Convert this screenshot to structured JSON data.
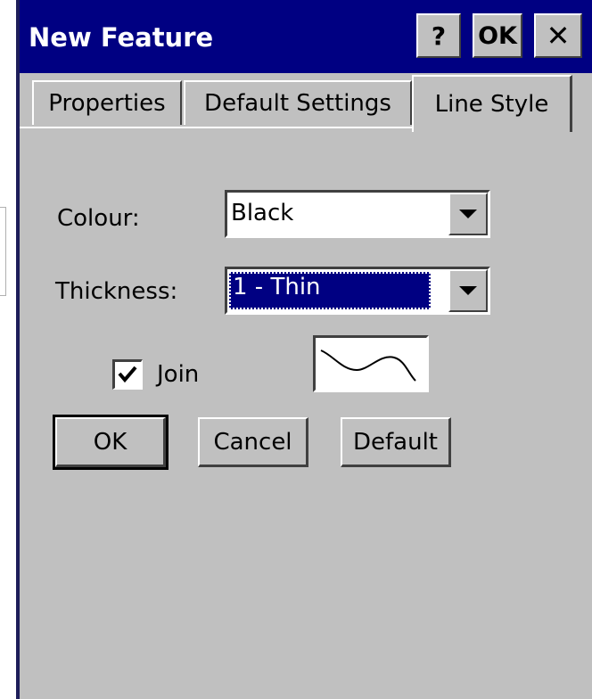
{
  "window": {
    "title": "New Feature",
    "help_label": "?",
    "ok_label": "OK",
    "close_label": "✕"
  },
  "tabs": [
    {
      "label": "Properties",
      "active": false
    },
    {
      "label": "Default Settings",
      "active": false
    },
    {
      "label": "Line Style",
      "active": true
    }
  ],
  "form": {
    "colour_label": "Colour:",
    "colour_value": "Black",
    "thickness_label": "Thickness:",
    "thickness_value": "1 - Thin",
    "join_label": "Join",
    "join_checked": true
  },
  "buttons": {
    "ok": "OK",
    "cancel": "Cancel",
    "default": "Default"
  },
  "colors": {
    "titlebar": "#000082",
    "face": "#c0c0c0",
    "selection": "#000082"
  }
}
